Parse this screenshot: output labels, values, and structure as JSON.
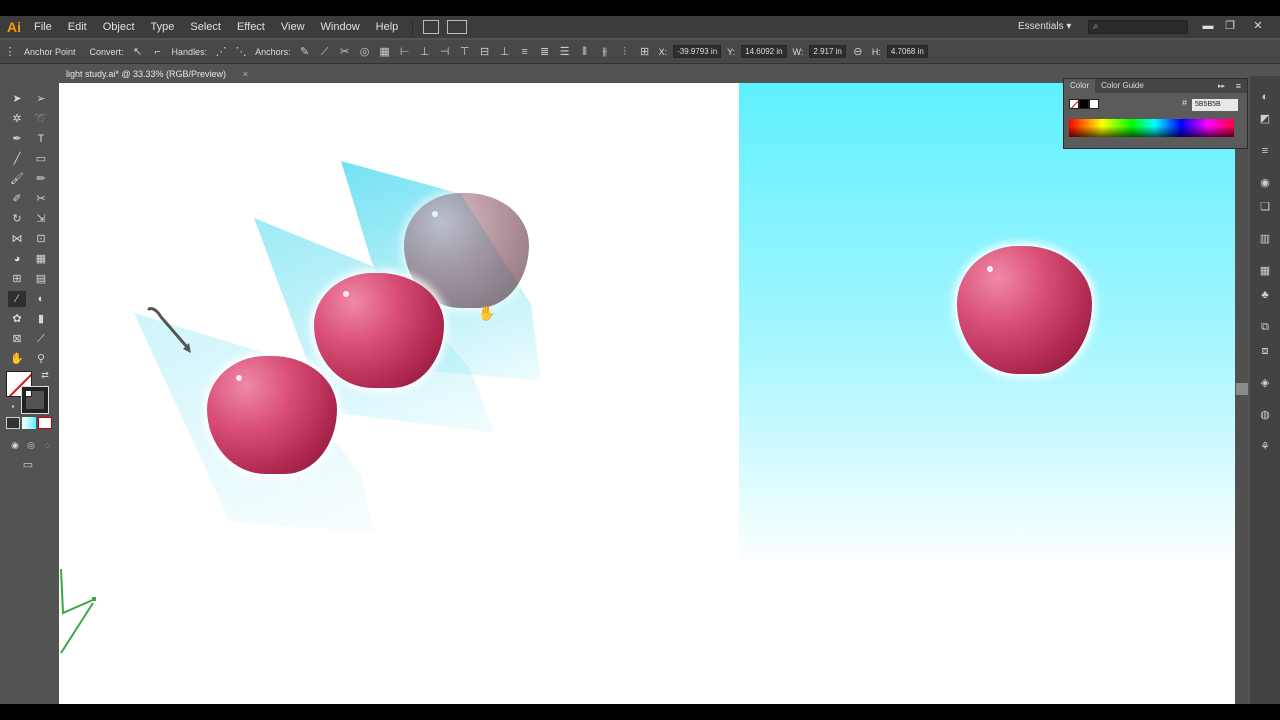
{
  "app": {
    "logo": "Ai"
  },
  "menu": [
    "File",
    "Edit",
    "Object",
    "Type",
    "Select",
    "Effect",
    "View",
    "Window",
    "Help"
  ],
  "workspace": {
    "label": "Essentials ▾",
    "search_glyph": "⌕"
  },
  "window_controls": {
    "minimize": "▬",
    "restore": "❐",
    "close": "✕"
  },
  "control_bar": {
    "tool_label": "Anchor Point",
    "convert_label": "Convert:",
    "handles_label": "Handles:",
    "anchors_label": "Anchors:",
    "x_label": "X:",
    "x_value": "-39.9793 in",
    "y_label": "Y:",
    "y_value": "14.6092 in",
    "w_label": "W:",
    "w_value": "2.917 in",
    "h_label": "H:",
    "h_value": "4.7068 in"
  },
  "document_tab": {
    "title": "light study.ai* @ 33.33% (RGB/Preview)",
    "close": "×"
  },
  "color_panel": {
    "tabs": [
      "Color",
      "Color Guide"
    ],
    "hash": "#",
    "hex_value": "5B5B5B",
    "menu_glyph": "≡",
    "expand_glyph": "▸▸"
  },
  "colors": {
    "accent": "#ff9a00",
    "panel": "#535353",
    "blue_bg": "#5ef0ff",
    "blob": "#d94f78"
  },
  "icons": {
    "tools": [
      "selection-icon",
      "direct-selection-icon",
      "magic-wand-icon",
      "lasso-icon",
      "pen-icon",
      "type-icon",
      "line-icon",
      "rectangle-icon",
      "paintbrush-icon",
      "pencil-icon",
      "blob-brush-icon",
      "eraser-icon",
      "rotate-icon",
      "scale-icon",
      "width-icon",
      "free-transform-icon",
      "shape-builder-icon",
      "perspective-grid-icon",
      "mesh-icon",
      "gradient-icon",
      "eyedropper-icon",
      "blend-icon",
      "symbol-sprayer-icon",
      "column-graph-icon",
      "artboard-icon",
      "slice-icon",
      "hand-icon",
      "zoom-icon"
    ]
  }
}
